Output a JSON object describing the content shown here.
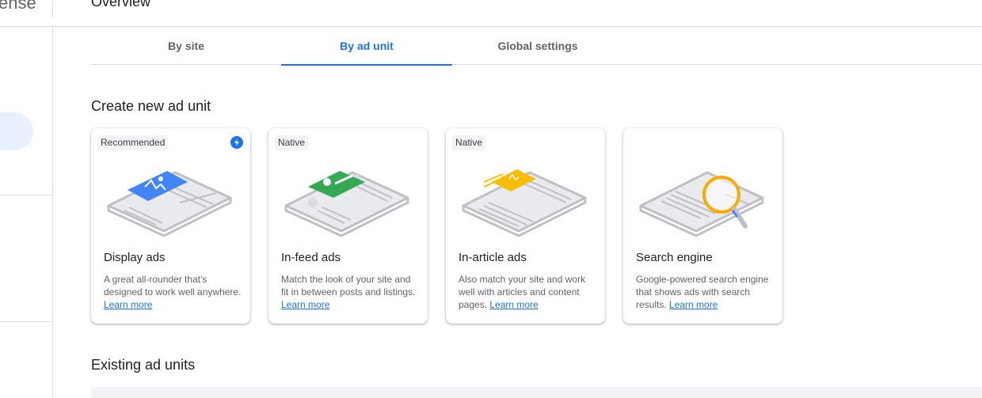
{
  "app": {
    "brand_fragment": "ense",
    "page_title": "Overview"
  },
  "tabs": [
    {
      "label": "By site",
      "active": false
    },
    {
      "label": "By ad unit",
      "active": true
    },
    {
      "label": "Global settings",
      "active": false
    }
  ],
  "create_section": {
    "title": "Create new ad unit"
  },
  "cards": [
    {
      "badge": "Recommended",
      "has_bolt_icon": true,
      "icon": "display-ads-illustration",
      "accent": "#4285f4",
      "title": "Display ads",
      "description": "A great all-rounder that's designed to work well anywhere.",
      "link": "Learn more"
    },
    {
      "badge": "Native",
      "has_bolt_icon": false,
      "icon": "in-feed-ads-illustration",
      "accent": "#34a853",
      "title": "In-feed ads",
      "description": "Match the look of your site and fit in between posts and listings.",
      "link": "Learn more"
    },
    {
      "badge": "Native",
      "has_bolt_icon": false,
      "icon": "in-article-ads-illustration",
      "accent": "#fbbc04",
      "title": "In-article ads",
      "description": "Also match your site and work well with articles and content pages.",
      "link": "Learn more"
    },
    {
      "badge": "",
      "has_bolt_icon": false,
      "icon": "search-engine-illustration",
      "accent": "#f9ab00",
      "title": "Search engine",
      "description": "Google-powered search engine that shows ads with search results.",
      "link": "Learn more"
    }
  ],
  "existing_section": {
    "title": "Existing ad units"
  },
  "colors": {
    "primary": "#1a73e8",
    "border": "#dadce0",
    "text": "#202124",
    "secondary_text": "#5f6368"
  }
}
